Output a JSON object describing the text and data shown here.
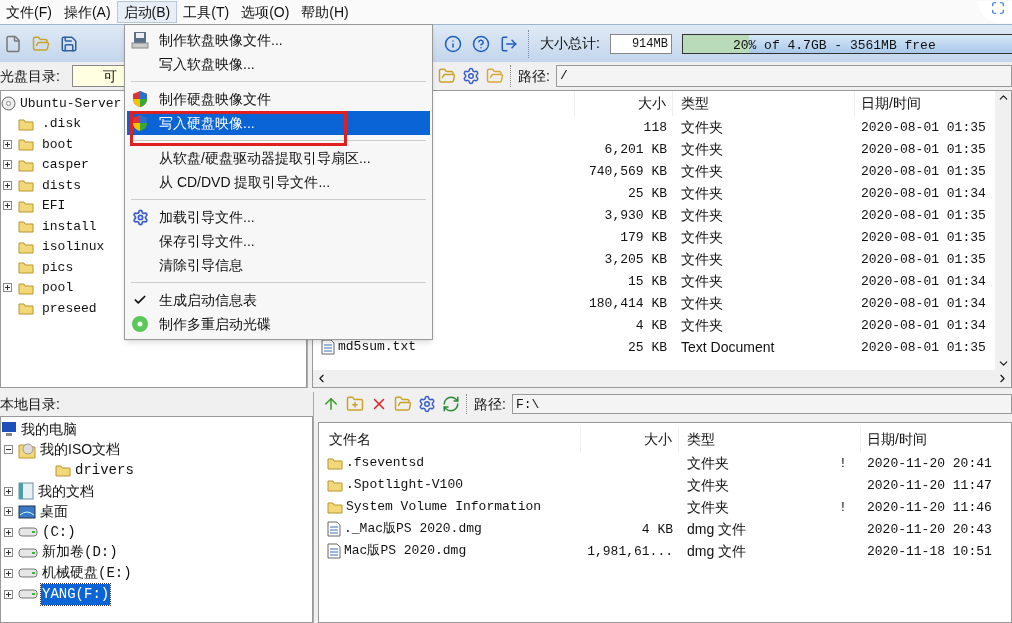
{
  "menu_bar": [
    {
      "label": "文件(F)",
      "selected": false
    },
    {
      "label": "操作(A)",
      "selected": false
    },
    {
      "label": "启动(B)",
      "selected": true
    },
    {
      "label": "工具(T)",
      "selected": false
    },
    {
      "label": "选项(O)",
      "selected": false
    },
    {
      "label": "帮助(H)",
      "selected": false
    }
  ],
  "toolbar": {
    "total_label": "大小总计:",
    "total_value": "914MB",
    "capacity": {
      "level": 0.2,
      "text": "20% of 4.7GB - 3561MB free"
    }
  },
  "open_menu": [
    {
      "kind": "floppy",
      "label": "制作软盘映像文件...",
      "selected": false,
      "checked": false
    },
    {
      "kind": "plain",
      "label": "写入软盘映像...",
      "selected": false,
      "checked": false
    },
    {
      "kind": "separator"
    },
    {
      "kind": "shield",
      "label": "制作硬盘映像文件",
      "selected": false,
      "checked": false
    },
    {
      "kind": "shield",
      "label": "写入硬盘映像...",
      "selected": true,
      "checked": false
    },
    {
      "kind": "separator"
    },
    {
      "kind": "plain",
      "label": "从软盘/硬盘驱动器提取引导扇区...",
      "selected": false,
      "checked": false
    },
    {
      "kind": "plain",
      "label": "从 CD/DVD 提取引导文件...",
      "selected": false,
      "checked": false
    },
    {
      "kind": "separator"
    },
    {
      "kind": "gear",
      "label": "加载引导文件...",
      "selected": false,
      "checked": false
    },
    {
      "kind": "plain",
      "label": "保存引导文件...",
      "selected": false,
      "checked": false
    },
    {
      "kind": "plain",
      "label": "清除引导信息",
      "selected": false,
      "checked": false
    },
    {
      "kind": "separator"
    },
    {
      "kind": "plain",
      "label": "生成启动信息表",
      "selected": false,
      "checked": true
    },
    {
      "kind": "disc",
      "label": "制作多重启动光碟",
      "selected": false,
      "checked": false
    }
  ],
  "iso_pane": {
    "label": "光盘目录:",
    "field": "可",
    "path_label": "路径:",
    "path": "/",
    "tree": {
      "label": "Ubuntu-Server",
      "children": [
        {
          "label": ".disk",
          "kind": "leaf"
        },
        {
          "label": "boot",
          "kind": "collapsed"
        },
        {
          "label": "casper",
          "kind": "collapsed"
        },
        {
          "label": "dists",
          "kind": "collapsed"
        },
        {
          "label": "EFI",
          "kind": "collapsed"
        },
        {
          "label": "install",
          "kind": "leaf"
        },
        {
          "label": "isolinux",
          "kind": "leaf"
        },
        {
          "label": "pics",
          "kind": "leaf"
        },
        {
          "label": "pool",
          "kind": "collapsed"
        },
        {
          "label": "preseed",
          "kind": "leaf"
        }
      ]
    },
    "columns": [
      "大小",
      "类型",
      "日期/时间"
    ],
    "rows": [
      {
        "size": "118",
        "type": "文件夹",
        "date": "2020-08-01 01:35"
      },
      {
        "size": "6,201 KB",
        "type": "文件夹",
        "date": "2020-08-01 01:35"
      },
      {
        "size": "740,569 KB",
        "type": "文件夹",
        "date": "2020-08-01 01:35"
      },
      {
        "size": "25 KB",
        "type": "文件夹",
        "date": "2020-08-01 01:34"
      },
      {
        "size": "3,930 KB",
        "type": "文件夹",
        "date": "2020-08-01 01:35"
      },
      {
        "size": "179 KB",
        "type": "文件夹",
        "date": "2020-08-01 01:35"
      },
      {
        "size": "3,205 KB",
        "type": "文件夹",
        "date": "2020-08-01 01:35"
      },
      {
        "size": "15 KB",
        "type": "文件夹",
        "date": "2020-08-01 01:34"
      },
      {
        "size": "180,414 KB",
        "type": "文件夹",
        "date": "2020-08-01 01:34"
      },
      {
        "size": "4 KB",
        "type": "文件夹",
        "date": "2020-08-01 01:34"
      },
      {
        "kind": "file",
        "name": "md5sum.txt",
        "size": "25 KB",
        "type": "Text Document",
        "date": "2020-08-01 01:35"
      }
    ]
  },
  "local_pane": {
    "label": "本地目录:",
    "path_label": "路径:",
    "path": "F:\\",
    "tree": {
      "label": "我的电脑",
      "kind": "computer",
      "selected": false,
      "children": [
        {
          "label": "我的ISO文档",
          "kind": "iso",
          "expanded": true,
          "selected": false,
          "children": [
            {
              "label": "drivers",
              "kind": "folder",
              "selected": false
            }
          ]
        },
        {
          "label": "我的文档",
          "kind": "documents",
          "expanded": false,
          "selected": false
        },
        {
          "label": "桌面",
          "kind": "desktop",
          "expanded": false,
          "selected": false
        },
        {
          "label": "(C:)",
          "kind": "drive",
          "expanded": false,
          "selected": false
        },
        {
          "label": "新加卷(D:)",
          "kind": "drive",
          "expanded": false,
          "selected": false
        },
        {
          "label": "机械硬盘(E:)",
          "kind": "drive",
          "expanded": false,
          "selected": false
        },
        {
          "label": "YANG(F:)",
          "kind": "drive",
          "expanded": false,
          "selected": true
        }
      ]
    },
    "columns": [
      "文件名",
      "大小",
      "类型",
      "日期/时间"
    ],
    "rows": [
      {
        "kind": "folder",
        "name": ".fseventsd",
        "type": "文件夹",
        "flag": "!",
        "date": "2020-11-20 20:41"
      },
      {
        "kind": "folder",
        "name": ".Spotlight-V100",
        "type": "文件夹",
        "date": "2020-11-20 11:47"
      },
      {
        "kind": "folder",
        "name": "System Volume Information",
        "type": "文件夹",
        "flag": "!",
        "date": "2020-11-20 11:46"
      },
      {
        "kind": "file",
        "name": "._Mac版PS 2020.dmg",
        "size": "4 KB",
        "type": "dmg 文件",
        "date": "2020-11-20 20:43"
      },
      {
        "kind": "file",
        "name": "Mac版PS 2020.dmg",
        "size": "1,981,61...",
        "type": "dmg 文件",
        "date": "2020-11-18 10:51"
      }
    ]
  }
}
